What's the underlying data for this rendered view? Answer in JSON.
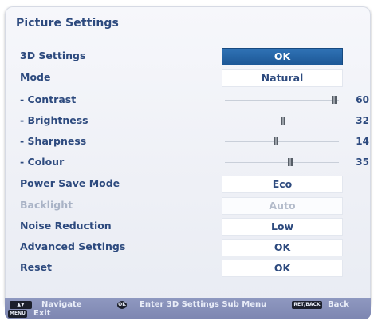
{
  "title": "Picture Settings",
  "rows": {
    "settings_3d": {
      "label": "3D Settings",
      "value": "OK"
    },
    "mode": {
      "label": "Mode",
      "value": "Natural"
    },
    "contrast": {
      "label": "- Contrast",
      "value": "60",
      "level": 0.96
    },
    "brightness": {
      "label": "- Brightness",
      "value": "32",
      "level": 0.51
    },
    "sharpness": {
      "label": "- Sharpness",
      "value": "14",
      "level": 0.45
    },
    "colour": {
      "label": "- Colour",
      "value": "35",
      "level": 0.57
    },
    "power_save": {
      "label": "Power Save Mode",
      "value": "Eco"
    },
    "backlight": {
      "label": "Backlight",
      "value": "Auto"
    },
    "noise_reduction": {
      "label": "Noise Reduction",
      "value": "Low"
    },
    "advanced": {
      "label": "Advanced Settings",
      "value": "OK"
    },
    "reset": {
      "label": "Reset",
      "value": "OK"
    }
  },
  "footer": {
    "navigate": "Navigate",
    "ok_key": "OK",
    "enter": "Enter 3D Settings Sub Menu",
    "back_key": "RET/BACK",
    "back": "Back",
    "menu_key": "MENU",
    "exit": "Exit"
  },
  "colors": {
    "accent": "#2f72b5",
    "text": "#2d4a7e",
    "footer": "#8f98c0"
  }
}
